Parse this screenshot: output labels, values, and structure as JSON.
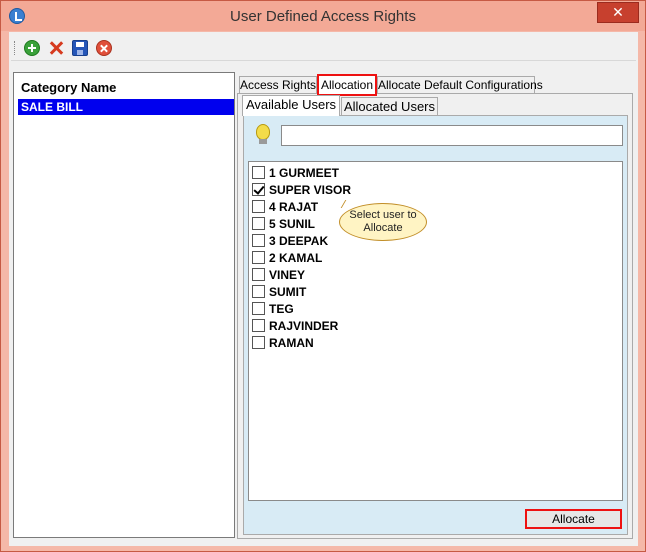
{
  "window": {
    "title": "User Defined Access Rights",
    "close_label": "✕"
  },
  "toolbar": {
    "items": [
      {
        "icon": "add-icon"
      },
      {
        "icon": "delete-icon"
      },
      {
        "icon": "save-icon"
      },
      {
        "icon": "cancel-icon"
      }
    ]
  },
  "category": {
    "header": "Category Name",
    "items": [
      "SALE BILL"
    ]
  },
  "tabs": [
    "Access Rights",
    "Allocation",
    "Allocate Default Configurations"
  ],
  "subtabs": [
    "Available Users",
    "Allocated Users"
  ],
  "search": {
    "value": ""
  },
  "users": [
    {
      "name": "1 GURMEET",
      "checked": false
    },
    {
      "name": "SUPER VISOR",
      "checked": true
    },
    {
      "name": "4 RAJAT",
      "checked": false
    },
    {
      "name": "5 SUNIL",
      "checked": false
    },
    {
      "name": "3 DEEPAK",
      "checked": false
    },
    {
      "name": "2 KAMAL",
      "checked": false
    },
    {
      "name": "VINEY",
      "checked": false
    },
    {
      "name": "SUMIT",
      "checked": false
    },
    {
      "name": "TEG",
      "checked": false
    },
    {
      "name": "RAJVINDER",
      "checked": false
    },
    {
      "name": "RAMAN",
      "checked": false
    }
  ],
  "tooltip": {
    "text": "Select user to Allocate"
  },
  "allocate_button": "Allocate"
}
